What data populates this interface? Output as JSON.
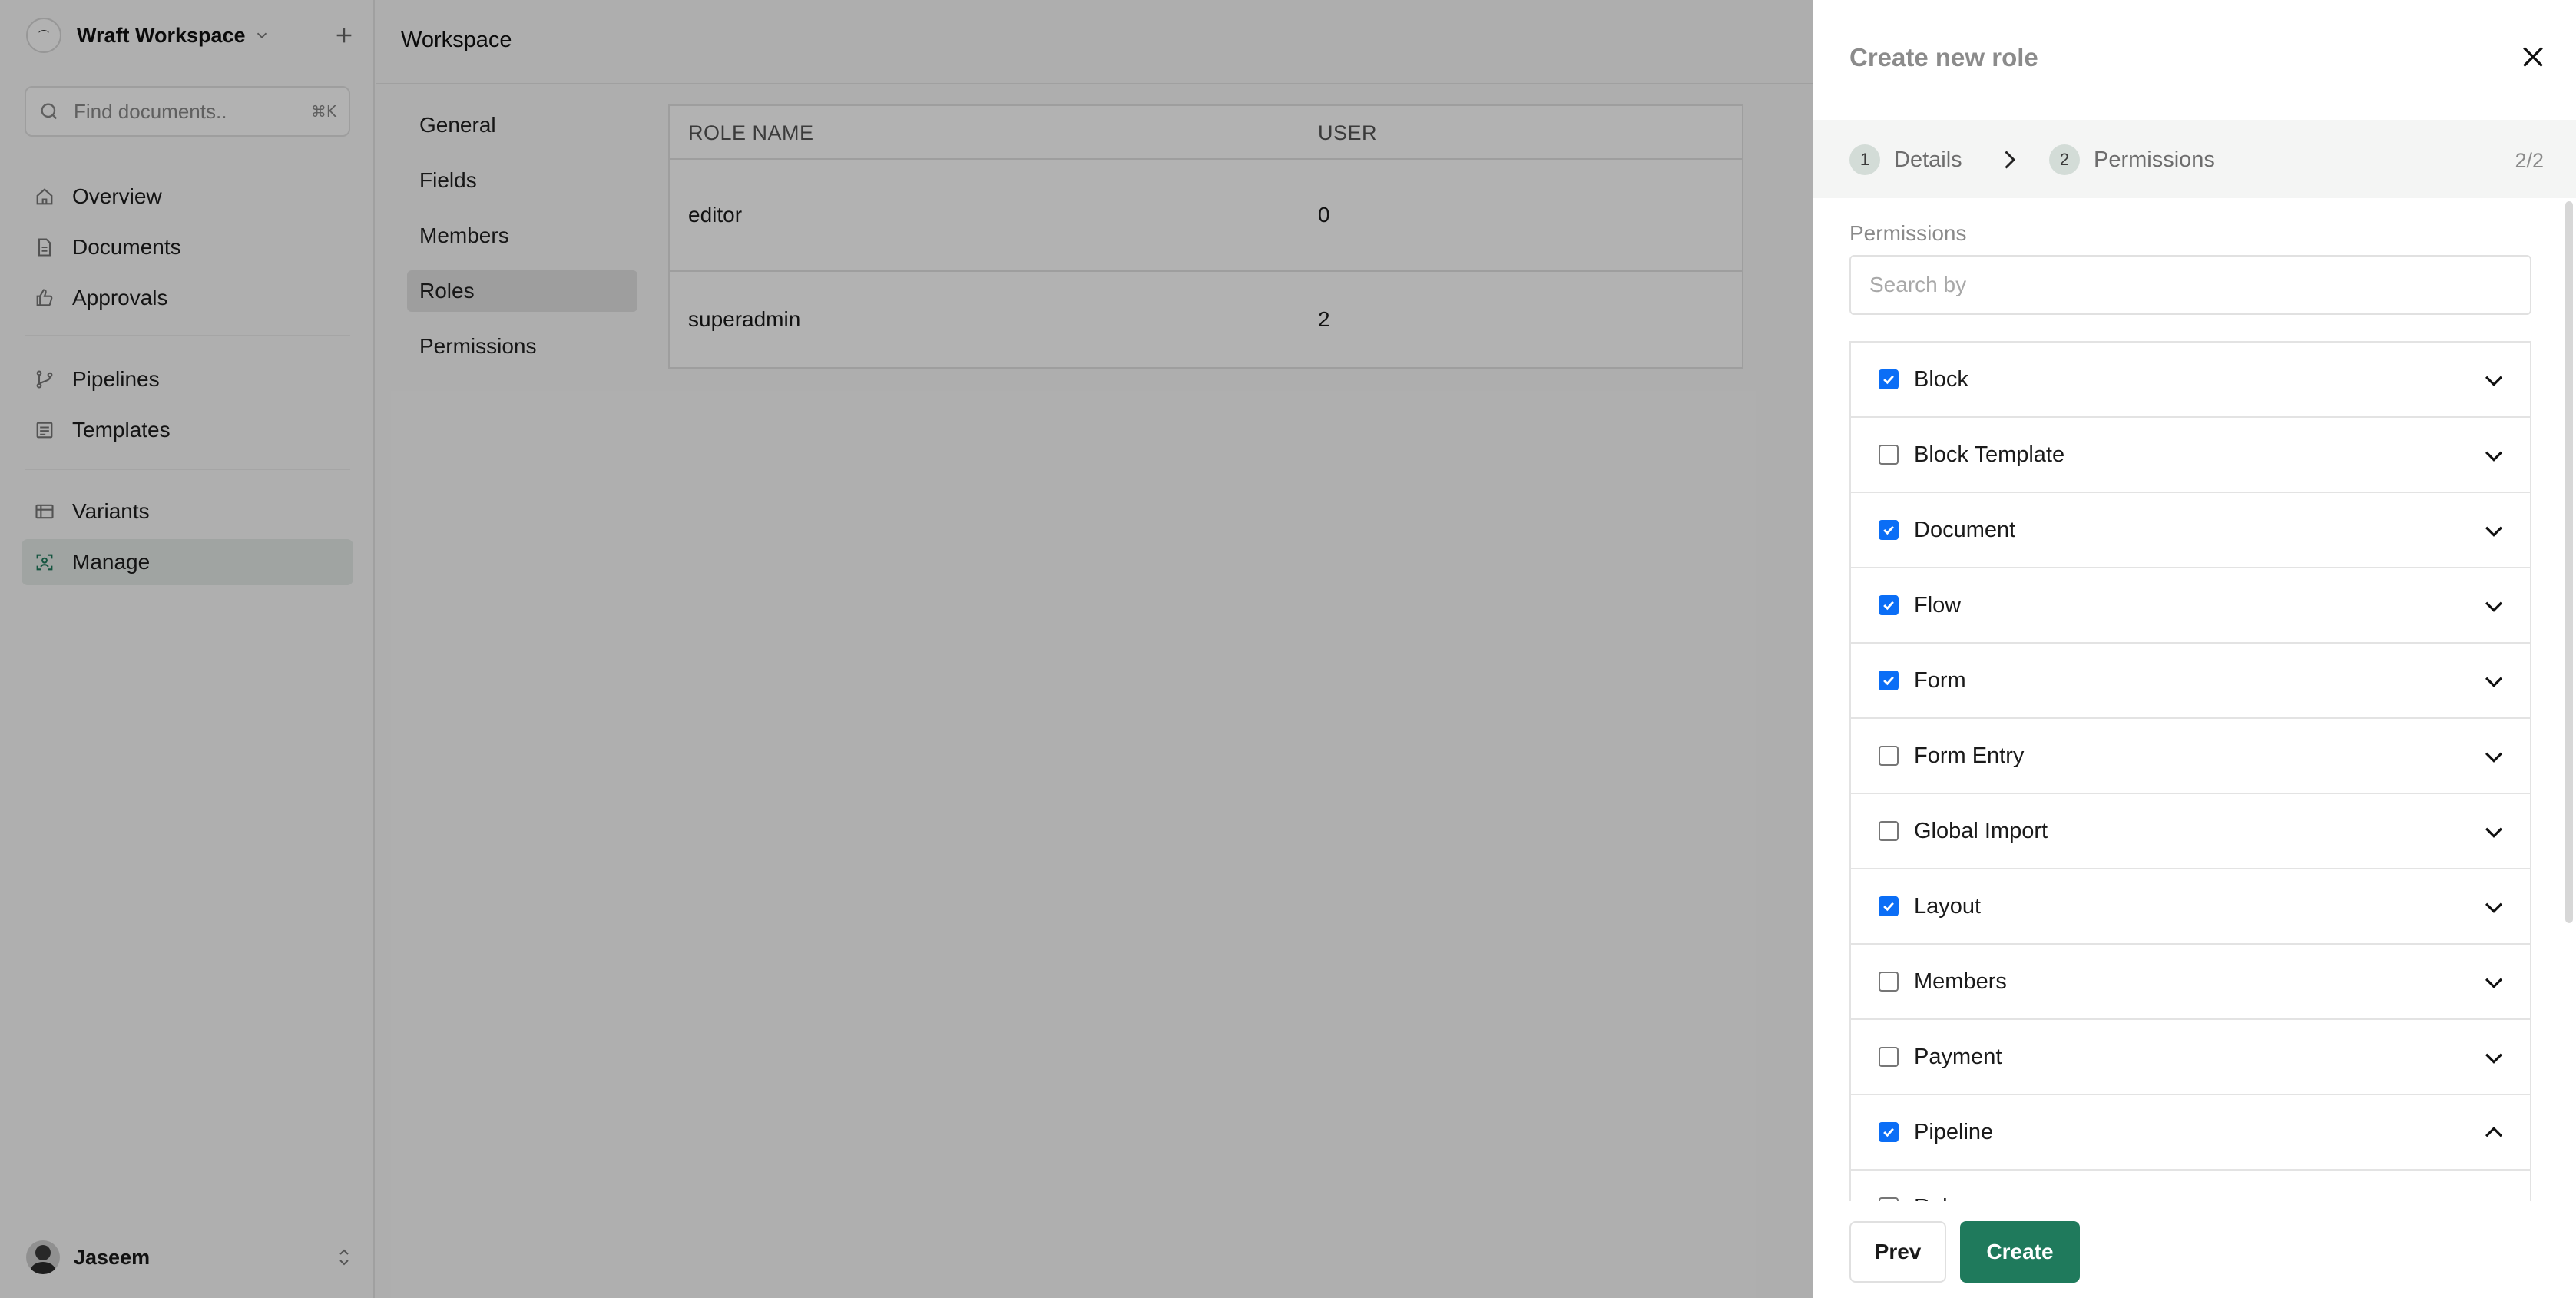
{
  "sidebar": {
    "workspace_name": "Wraft Workspace",
    "search_placeholder": "Find documents..",
    "search_shortcut": "⌘K",
    "nav": [
      {
        "label": "Overview",
        "icon": "home-icon"
      },
      {
        "label": "Documents",
        "icon": "document-icon"
      },
      {
        "label": "Approvals",
        "icon": "thumbs-up-icon"
      },
      {
        "label": "Pipelines",
        "icon": "branch-icon"
      },
      {
        "label": "Templates",
        "icon": "template-icon"
      },
      {
        "label": "Variants",
        "icon": "variants-icon"
      },
      {
        "label": "Manage",
        "icon": "manage-icon",
        "active": true
      }
    ],
    "user_name": "Jaseem"
  },
  "main": {
    "title": "Workspace",
    "subnav": [
      "General",
      "Fields",
      "Members",
      "Roles",
      "Permissions"
    ],
    "active_subnav": "Roles",
    "table": {
      "headers": [
        "ROLE NAME",
        "USER"
      ],
      "rows": [
        {
          "role": "editor",
          "users": "0"
        },
        {
          "role": "superadmin",
          "users": "2"
        }
      ]
    }
  },
  "drawer": {
    "title": "Create new role",
    "steps": [
      {
        "num": "1",
        "label": "Details"
      },
      {
        "num": "2",
        "label": "Permissions"
      }
    ],
    "step_count": "2/2",
    "permissions_label": "Permissions",
    "search_placeholder": "Search by",
    "permissions": [
      {
        "name": "Block",
        "checked": true,
        "expanded": false
      },
      {
        "name": "Block Template",
        "checked": false,
        "expanded": false
      },
      {
        "name": "Document",
        "checked": true,
        "expanded": false
      },
      {
        "name": "Flow",
        "checked": true,
        "expanded": false
      },
      {
        "name": "Form",
        "checked": true,
        "expanded": false
      },
      {
        "name": "Form Entry",
        "checked": false,
        "expanded": false
      },
      {
        "name": "Global Import",
        "checked": false,
        "expanded": false
      },
      {
        "name": "Layout",
        "checked": true,
        "expanded": false
      },
      {
        "name": "Members",
        "checked": false,
        "expanded": false
      },
      {
        "name": "Payment",
        "checked": false,
        "expanded": false
      },
      {
        "name": "Pipeline",
        "checked": true,
        "expanded": true
      },
      {
        "name": "Role",
        "checked": false,
        "expanded": false
      }
    ],
    "prev_label": "Prev",
    "create_label": "Create"
  },
  "colors": {
    "accent_green": "#1f7a5c",
    "checkbox_blue": "#0b6ef6"
  }
}
